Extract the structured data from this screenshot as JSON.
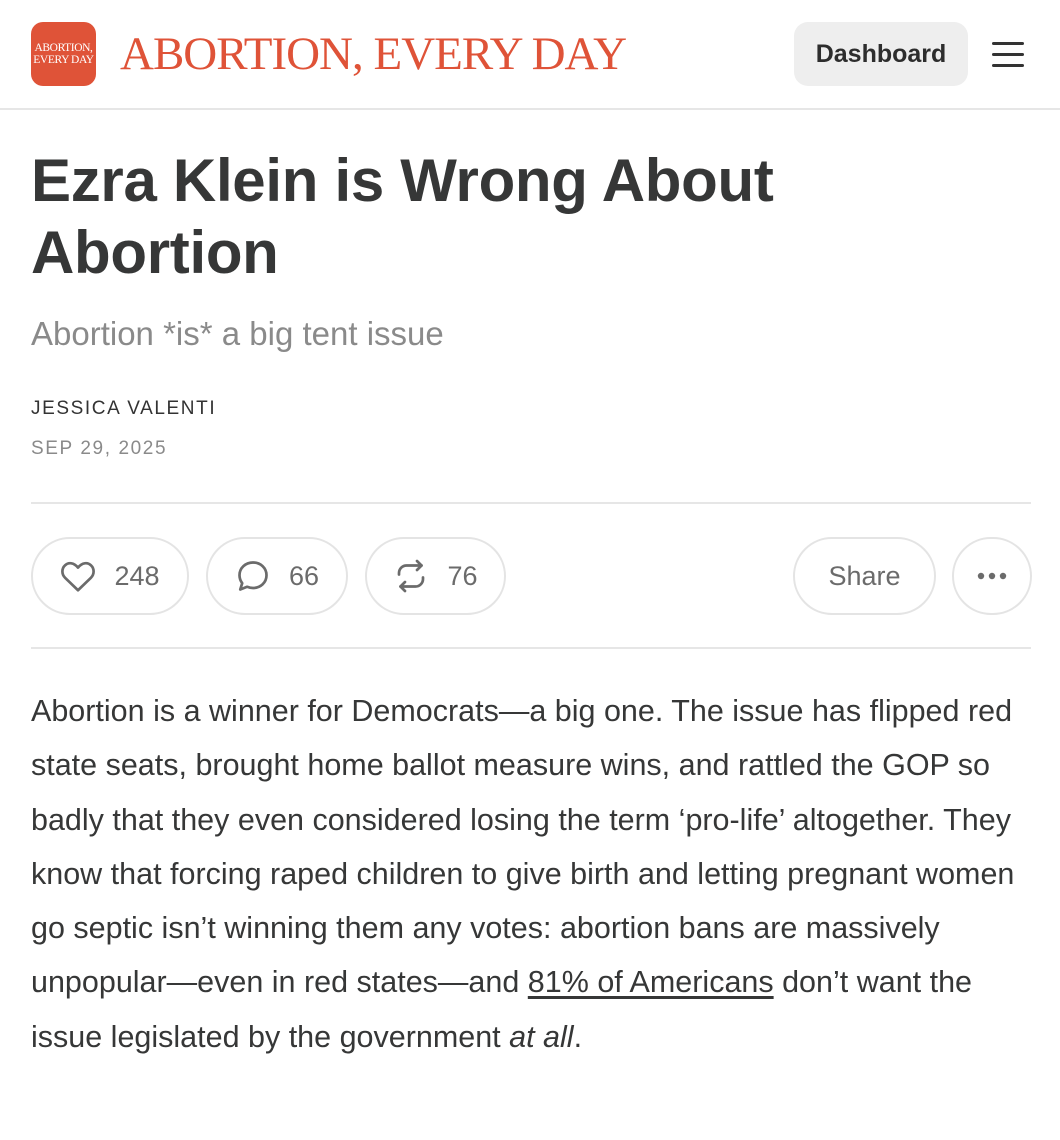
{
  "header": {
    "logo_line1": "ABORTION,",
    "logo_line2": "EVERY DAY",
    "site_title": "ABORTION, EVERY DAY",
    "dashboard_label": "Dashboard",
    "menu_icon": "hamburger-menu-icon",
    "brand_color": "#df5338"
  },
  "article": {
    "title": "Ezra Klein is Wrong About Abortion",
    "subtitle": "Abortion *is* a big tent issue",
    "author": "JESSICA VALENTI",
    "date": "SEP 29, 2025"
  },
  "actions": {
    "likes": "248",
    "comments": "66",
    "restacks": "76",
    "share_label": "Share",
    "like_icon": "heart-icon",
    "comment_icon": "comment-bubble-icon",
    "restack_icon": "restack-icon",
    "more_icon": "more-dots-icon"
  },
  "body": {
    "p1_before_link": "Abortion is a winner for Democrats—a big one. The issue has flipped red state seats, brought home ballot measure wins, and rattled the GOP so badly that they even considered losing the term ‘pro-life’ altogether. They know that forcing raped children to give birth and letting pregnant women go septic isn’t winning them any votes: abortion bans are massively unpopular—even in red states—and ",
    "p1_link": "81% of Americans",
    "p1_after_link": " don’t want the issue legislated by the government ",
    "p1_emphasis": "at all",
    "p1_end": "."
  }
}
